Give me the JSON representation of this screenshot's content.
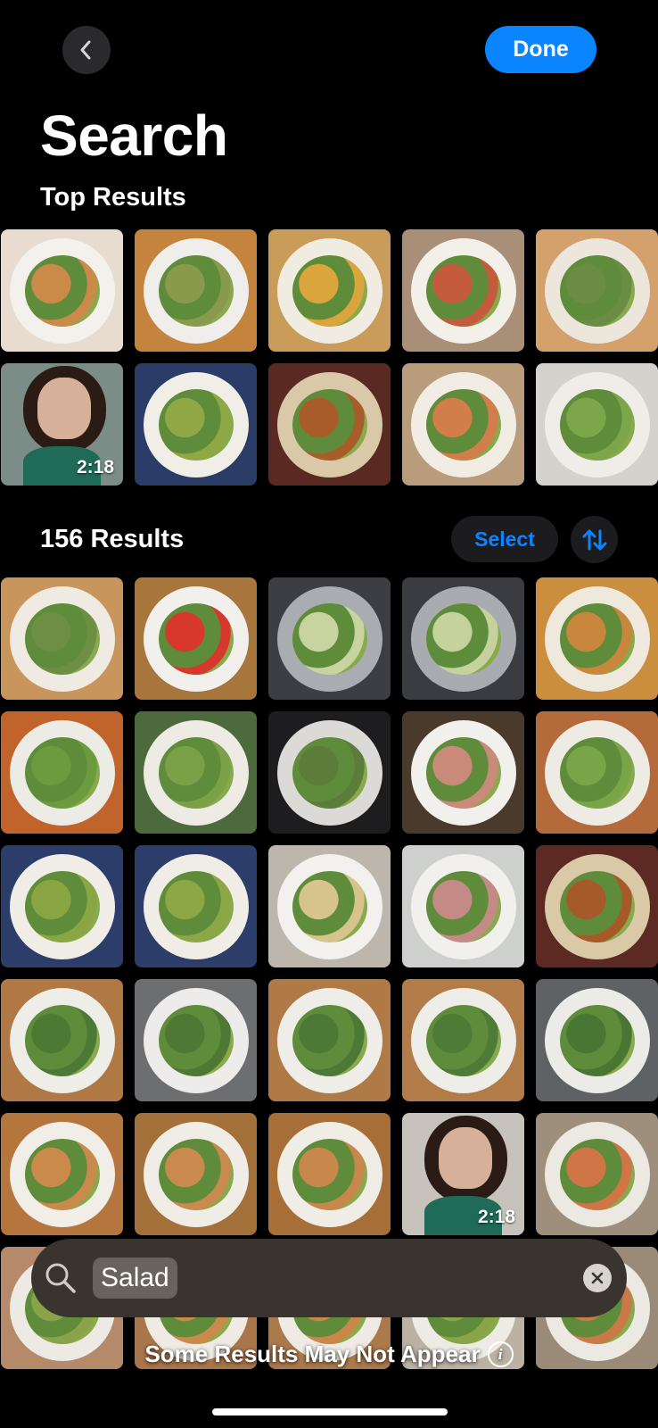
{
  "header": {
    "back_icon": "chevron-left-icon",
    "done_label": "Done",
    "title": "Search"
  },
  "top_results": {
    "heading": "Top Results",
    "tiles": [
      {
        "bg": "#e7dccf",
        "plate": "#f4f1ec",
        "food": "#c98a4a",
        "video": false
      },
      {
        "bg": "#c4843e",
        "plate": "#efeeea",
        "food": "#8a9a4c",
        "video": false
      },
      {
        "bg": "#c99c5a",
        "plate": "#f1ece2",
        "food": "#d9a53c",
        "video": false
      },
      {
        "bg": "#a98f78",
        "plate": "#f3efe9",
        "food": "#c35b3c",
        "video": false
      },
      {
        "bg": "#d4a06c",
        "plate": "#ece6dc",
        "food": "#6a8c44",
        "video": false
      },
      {
        "bg": "#7c8c86",
        "plate": null,
        "food": null,
        "video": true,
        "duration": "2:18"
      },
      {
        "bg": "#2b3c66",
        "plate": "#f1eee8",
        "food": "#8fa845",
        "video": false
      },
      {
        "bg": "#5a2a22",
        "plate": "#d9c9a8",
        "food": "#a85c2a",
        "video": false
      },
      {
        "bg": "#b89c7c",
        "plate": "#f2ede4",
        "food": "#d27e4a",
        "video": false
      },
      {
        "bg": "#d5d2ce",
        "plate": "#f0ede8",
        "food": "#7da64a",
        "video": false
      }
    ]
  },
  "results": {
    "heading": "156 Results",
    "select_label": "Select",
    "sort_icon": "sort-arrows-icon",
    "tiles": [
      {
        "bg": "#c8955c",
        "plate": "#efeae2",
        "food": "#6c8f44",
        "video": false
      },
      {
        "bg": "#a6763c",
        "plate": "#f2f0ec",
        "food": "#d8382c",
        "video": false
      },
      {
        "bg": "#3c3e44",
        "plate": "#a9acb0",
        "food": "#c8d4a0",
        "video": false
      },
      {
        "bg": "#3a3c42",
        "plate": "#a8abaf",
        "food": "#c6d29e",
        "video": false
      },
      {
        "bg": "#c98e3e",
        "plate": "#efe8dc",
        "food": "#c8873c",
        "video": false
      },
      {
        "bg": "#c0642c",
        "plate": "#ecebe6",
        "food": "#6c9a3e",
        "video": false
      },
      {
        "bg": "#4d6a3c",
        "plate": "#eeebe4",
        "food": "#7aa048",
        "video": false
      },
      {
        "bg": "#1d1d20",
        "plate": "#dcdad6",
        "food": "#5c7c3a",
        "video": false
      },
      {
        "bg": "#4a3a2c",
        "plate": "#f2f0ec",
        "food": "#c98a7a",
        "video": false
      },
      {
        "bg": "#b46a3a",
        "plate": "#eeebe5",
        "food": "#7aa448",
        "video": false
      },
      {
        "bg": "#2c3d6a",
        "plate": "#f0ede6",
        "food": "#8aa644",
        "video": false
      },
      {
        "bg": "#2c3d6a",
        "plate": "#f0ede6",
        "food": "#8ca746",
        "video": false
      },
      {
        "bg": "#bdb6ac",
        "plate": "#f2f1ee",
        "food": "#d6c48c",
        "video": false
      },
      {
        "bg": "#cdd0cc",
        "plate": "#f1f0ec",
        "food": "#c48a86",
        "video": false
      },
      {
        "bg": "#5c2a22",
        "plate": "#dac9a6",
        "food": "#a65a2a",
        "video": false
      },
      {
        "bg": "#b07844",
        "plate": "#efede8",
        "food": "#4c7a34",
        "video": false
      },
      {
        "bg": "#6c6e70",
        "plate": "#eeecea",
        "food": "#4e7834",
        "video": false
      },
      {
        "bg": "#b07a46",
        "plate": "#efede8",
        "food": "#4c7a36",
        "video": false
      },
      {
        "bg": "#b27c48",
        "plate": "#efede8",
        "food": "#4e7c36",
        "video": false
      },
      {
        "bg": "#5e6264",
        "plate": "#ecebe8",
        "food": "#4a7634",
        "video": false
      },
      {
        "bg": "#b5763e",
        "plate": "#f1eee8",
        "food": "#c98a4c",
        "video": false
      },
      {
        "bg": "#a4703a",
        "plate": "#f0ede6",
        "food": "#c88a4e",
        "video": false
      },
      {
        "bg": "#a86e38",
        "plate": "#f0ede6",
        "food": "#c8884c",
        "video": false
      },
      {
        "bg": "#c7c3bc",
        "plate": null,
        "food": null,
        "video": true,
        "duration": "2:18"
      },
      {
        "bg": "#9e8e7c",
        "plate": "#ece8e2",
        "food": "#d07646",
        "video": false
      },
      {
        "bg": "#b48a6a",
        "plate": "#ede9e3",
        "food": "#8aa24a",
        "video": false
      },
      {
        "bg": "#a8764a",
        "plate": "#efebe4",
        "food": "#c98a4c",
        "video": false
      },
      {
        "bg": "#ab7a4c",
        "plate": "#efebe4",
        "food": "#c9884a",
        "video": false
      },
      {
        "bg": "#bcb2a4",
        "plate": "#eeeae4",
        "food": "#8aa448",
        "video": false
      },
      {
        "bg": "#9a8a78",
        "plate": "#ece8e2",
        "food": "#c97a48",
        "video": false
      }
    ]
  },
  "search_bar": {
    "search_icon": "magnifier-icon",
    "query": "Salad",
    "clear_icon": "close-icon"
  },
  "notice": {
    "text": "Some Results May Not Appear",
    "info_icon": "info-icon"
  }
}
